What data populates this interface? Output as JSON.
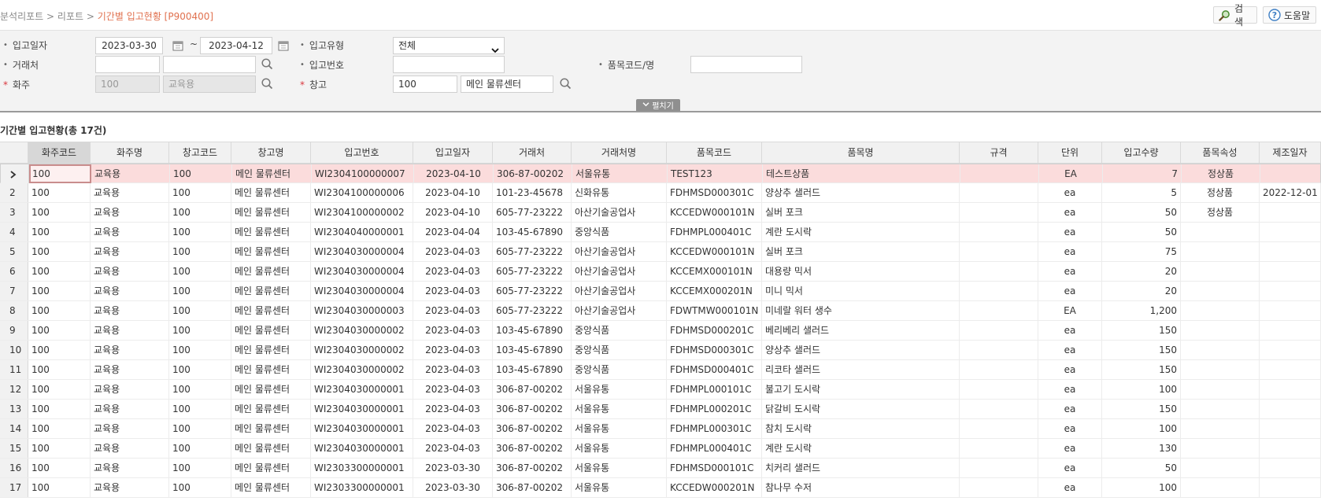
{
  "breadcrumb": {
    "part1": "분석리포트",
    "part2": "리포트",
    "current": "기간별 입고현황 [P900400]",
    "sep": ">"
  },
  "toolbar": {
    "search_label": "검색",
    "help_label": "도움말"
  },
  "filters": {
    "in_date_label": "입고일자",
    "date_from": "2023-03-30",
    "date_to": "2023-04-12",
    "tilde": "~",
    "in_type_label": "입고유형",
    "in_type_value": "전체",
    "partner_label": "거래처",
    "partner_code": "",
    "partner_name": "",
    "in_no_label": "입고번호",
    "in_no_value": "",
    "item_label": "품목코드/명",
    "item_value": "",
    "owner_label": "화주",
    "owner_code": "100",
    "owner_name": "교육용",
    "warehouse_label": "창고",
    "warehouse_code": "100",
    "warehouse_name": "메인 물류센터",
    "expand_label": "펼치기"
  },
  "grid": {
    "title": "기간별 입고현황(총 17건)",
    "columns": [
      "화주코드",
      "화주명",
      "창고코드",
      "창고명",
      "입고번호",
      "입고일자",
      "거래처",
      "거래처명",
      "품목코드",
      "품목명",
      "규격",
      "단위",
      "입고수량",
      "품목속성",
      "제조일자"
    ],
    "rows": [
      {
        "row_no": "",
        "owner_code": "100",
        "owner_name": "교육용",
        "wh_code": "100",
        "wh_name": "메인 물류센터",
        "in_no": "WI2304100000007",
        "in_date": "2023-04-10",
        "partner": "306-87-00202",
        "partner_name": "서울유통",
        "item_code": "TEST123",
        "item_name": "테스트상품",
        "spec": "",
        "unit": "EA",
        "qty": "7",
        "attr": "정상품",
        "mfg_date": ""
      },
      {
        "row_no": "2",
        "owner_code": "100",
        "owner_name": "교육용",
        "wh_code": "100",
        "wh_name": "메인 물류센터",
        "in_no": "WI2304100000006",
        "in_date": "2023-04-10",
        "partner": "101-23-45678",
        "partner_name": "신화유통",
        "item_code": "FDHMSD000301C",
        "item_name": "양상추 샐러드",
        "spec": "",
        "unit": "ea",
        "qty": "5",
        "attr": "정상품",
        "mfg_date": "2022-12-01"
      },
      {
        "row_no": "3",
        "owner_code": "100",
        "owner_name": "교육용",
        "wh_code": "100",
        "wh_name": "메인 물류센터",
        "in_no": "WI2304100000002",
        "in_date": "2023-04-10",
        "partner": "605-77-23222",
        "partner_name": "아산기술공업사",
        "item_code": "KCCEDW000101N",
        "item_name": "실버 포크",
        "spec": "",
        "unit": "ea",
        "qty": "50",
        "attr": "정상품",
        "mfg_date": ""
      },
      {
        "row_no": "4",
        "owner_code": "100",
        "owner_name": "교육용",
        "wh_code": "100",
        "wh_name": "메인 물류센터",
        "in_no": "WI2304040000001",
        "in_date": "2023-04-04",
        "partner": "103-45-67890",
        "partner_name": "중앙식품",
        "item_code": "FDHMPL000401C",
        "item_name": "계란 도시락",
        "spec": "",
        "unit": "ea",
        "qty": "50",
        "attr": "",
        "mfg_date": ""
      },
      {
        "row_no": "5",
        "owner_code": "100",
        "owner_name": "교육용",
        "wh_code": "100",
        "wh_name": "메인 물류센터",
        "in_no": "WI2304030000004",
        "in_date": "2023-04-03",
        "partner": "605-77-23222",
        "partner_name": "아산기술공업사",
        "item_code": "KCCEDW000101N",
        "item_name": "실버 포크",
        "spec": "",
        "unit": "ea",
        "qty": "75",
        "attr": "",
        "mfg_date": ""
      },
      {
        "row_no": "6",
        "owner_code": "100",
        "owner_name": "교육용",
        "wh_code": "100",
        "wh_name": "메인 물류센터",
        "in_no": "WI2304030000004",
        "in_date": "2023-04-03",
        "partner": "605-77-23222",
        "partner_name": "아산기술공업사",
        "item_code": "KCCEMX000101N",
        "item_name": "대용량 믹서",
        "spec": "",
        "unit": "ea",
        "qty": "20",
        "attr": "",
        "mfg_date": ""
      },
      {
        "row_no": "7",
        "owner_code": "100",
        "owner_name": "교육용",
        "wh_code": "100",
        "wh_name": "메인 물류센터",
        "in_no": "WI2304030000004",
        "in_date": "2023-04-03",
        "partner": "605-77-23222",
        "partner_name": "아산기술공업사",
        "item_code": "KCCEMX000201N",
        "item_name": "미니 믹서",
        "spec": "",
        "unit": "ea",
        "qty": "20",
        "attr": "",
        "mfg_date": ""
      },
      {
        "row_no": "8",
        "owner_code": "100",
        "owner_name": "교육용",
        "wh_code": "100",
        "wh_name": "메인 물류센터",
        "in_no": "WI2304030000003",
        "in_date": "2023-04-03",
        "partner": "605-77-23222",
        "partner_name": "아산기술공업사",
        "item_code": "FDWTMW000101N",
        "item_name": "미네랄 워터 생수",
        "spec": "",
        "unit": "EA",
        "qty": "1,200",
        "attr": "",
        "mfg_date": ""
      },
      {
        "row_no": "9",
        "owner_code": "100",
        "owner_name": "교육용",
        "wh_code": "100",
        "wh_name": "메인 물류센터",
        "in_no": "WI2304030000002",
        "in_date": "2023-04-03",
        "partner": "103-45-67890",
        "partner_name": "중앙식품",
        "item_code": "FDHMSD000201C",
        "item_name": "베리베리 샐러드",
        "spec": "",
        "unit": "ea",
        "qty": "150",
        "attr": "",
        "mfg_date": ""
      },
      {
        "row_no": "10",
        "owner_code": "100",
        "owner_name": "교육용",
        "wh_code": "100",
        "wh_name": "메인 물류센터",
        "in_no": "WI2304030000002",
        "in_date": "2023-04-03",
        "partner": "103-45-67890",
        "partner_name": "중앙식품",
        "item_code": "FDHMSD000301C",
        "item_name": "양상추 샐러드",
        "spec": "",
        "unit": "ea",
        "qty": "150",
        "attr": "",
        "mfg_date": ""
      },
      {
        "row_no": "11",
        "owner_code": "100",
        "owner_name": "교육용",
        "wh_code": "100",
        "wh_name": "메인 물류센터",
        "in_no": "WI2304030000002",
        "in_date": "2023-04-03",
        "partner": "103-45-67890",
        "partner_name": "중앙식품",
        "item_code": "FDHMSD000401C",
        "item_name": "리코타 샐러드",
        "spec": "",
        "unit": "ea",
        "qty": "150",
        "attr": "",
        "mfg_date": ""
      },
      {
        "row_no": "12",
        "owner_code": "100",
        "owner_name": "교육용",
        "wh_code": "100",
        "wh_name": "메인 물류센터",
        "in_no": "WI2304030000001",
        "in_date": "2023-04-03",
        "partner": "306-87-00202",
        "partner_name": "서울유통",
        "item_code": "FDHMPL000101C",
        "item_name": "불고기 도시락",
        "spec": "",
        "unit": "ea",
        "qty": "100",
        "attr": "",
        "mfg_date": ""
      },
      {
        "row_no": "13",
        "owner_code": "100",
        "owner_name": "교육용",
        "wh_code": "100",
        "wh_name": "메인 물류센터",
        "in_no": "WI2304030000001",
        "in_date": "2023-04-03",
        "partner": "306-87-00202",
        "partner_name": "서울유통",
        "item_code": "FDHMPL000201C",
        "item_name": "닭갈비 도시락",
        "spec": "",
        "unit": "ea",
        "qty": "150",
        "attr": "",
        "mfg_date": ""
      },
      {
        "row_no": "14",
        "owner_code": "100",
        "owner_name": "교육용",
        "wh_code": "100",
        "wh_name": "메인 물류센터",
        "in_no": "WI2304030000001",
        "in_date": "2023-04-03",
        "partner": "306-87-00202",
        "partner_name": "서울유통",
        "item_code": "FDHMPL000301C",
        "item_name": "참치 도시락",
        "spec": "",
        "unit": "ea",
        "qty": "100",
        "attr": "",
        "mfg_date": ""
      },
      {
        "row_no": "15",
        "owner_code": "100",
        "owner_name": "교육용",
        "wh_code": "100",
        "wh_name": "메인 물류센터",
        "in_no": "WI2304030000001",
        "in_date": "2023-04-03",
        "partner": "306-87-00202",
        "partner_name": "서울유통",
        "item_code": "FDHMPL000401C",
        "item_name": "계란 도시락",
        "spec": "",
        "unit": "ea",
        "qty": "130",
        "attr": "",
        "mfg_date": ""
      },
      {
        "row_no": "16",
        "owner_code": "100",
        "owner_name": "교육용",
        "wh_code": "100",
        "wh_name": "메인 물류센터",
        "in_no": "WI2303300000001",
        "in_date": "2023-03-30",
        "partner": "306-87-00202",
        "partner_name": "서울유통",
        "item_code": "FDHMSD000101C",
        "item_name": "치커리 샐러드",
        "spec": "",
        "unit": "ea",
        "qty": "50",
        "attr": "",
        "mfg_date": ""
      },
      {
        "row_no": "17",
        "owner_code": "100",
        "owner_name": "교육용",
        "wh_code": "100",
        "wh_name": "메인 물류센터",
        "in_no": "WI2303300000001",
        "in_date": "2023-03-30",
        "partner": "306-87-00202",
        "partner_name": "서울유통",
        "item_code": "KCCEDW000201N",
        "item_name": "참나무 수저",
        "spec": "",
        "unit": "ea",
        "qty": "100",
        "attr": "",
        "mfg_date": ""
      }
    ]
  },
  "colors": {
    "accent": "#e0714f",
    "selected_row": "#fbdcdc",
    "required": "#d9363e"
  }
}
